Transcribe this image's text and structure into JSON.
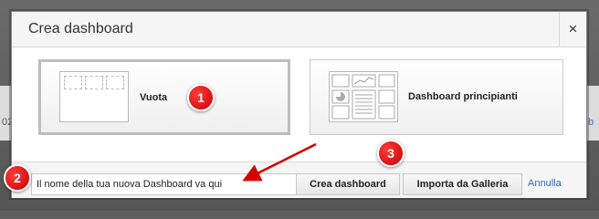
{
  "background": {
    "left_text": "02",
    "right_text": "b"
  },
  "dialog": {
    "title": "Crea dashboard",
    "close_symbol": "×",
    "options": [
      {
        "label": "Vuota",
        "selected": true
      },
      {
        "label": "Dashboard principianti",
        "selected": false
      }
    ],
    "footer": {
      "name_value": "Il nome della tua nuova Dashboard va qui",
      "create_label": "Crea dashboard",
      "import_label": "Importa da Galleria",
      "cancel_label": "Annulla"
    }
  },
  "annotations": {
    "badges": [
      "1",
      "2",
      "3"
    ],
    "color": "#d40000"
  }
}
